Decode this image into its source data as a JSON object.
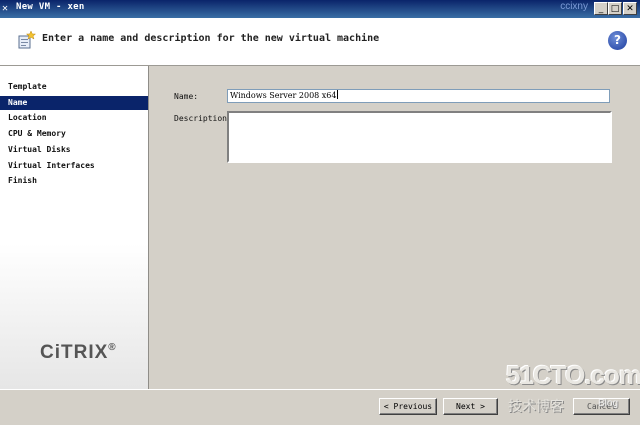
{
  "window": {
    "title": "New VM - xen",
    "watermark": "ccixny",
    "minimize_glyph": "_",
    "maximize_glyph": "□",
    "close_glyph": "✕"
  },
  "header": {
    "title": "Enter a name and description for the new virtual machine",
    "icon": "wizard-icon",
    "help_glyph": "?"
  },
  "nav": {
    "items": [
      {
        "label": "Template"
      },
      {
        "label": "Name"
      },
      {
        "label": "Location"
      },
      {
        "label": "CPU & Memory"
      },
      {
        "label": "Virtual Disks"
      },
      {
        "label": "Virtual Interfaces"
      },
      {
        "label": "Finish"
      }
    ],
    "active_index": 1,
    "logo": "CiTRIX",
    "logo_mark": "®"
  },
  "form": {
    "name_label": "Name:",
    "name_value": "Windows Server 2008 x64",
    "description_label": "Description:",
    "description_value": ""
  },
  "footer": {
    "previous_label": "< Previous",
    "next_label": "Next >",
    "cancel_label": "Cancel"
  },
  "watermark": {
    "line1": "51CTO.com",
    "line2": "技术博客",
    "line3": "Blog"
  },
  "colors": {
    "selection": "#0a246a",
    "titlebar": "#0a246a",
    "panel": "#d4d0c8"
  }
}
